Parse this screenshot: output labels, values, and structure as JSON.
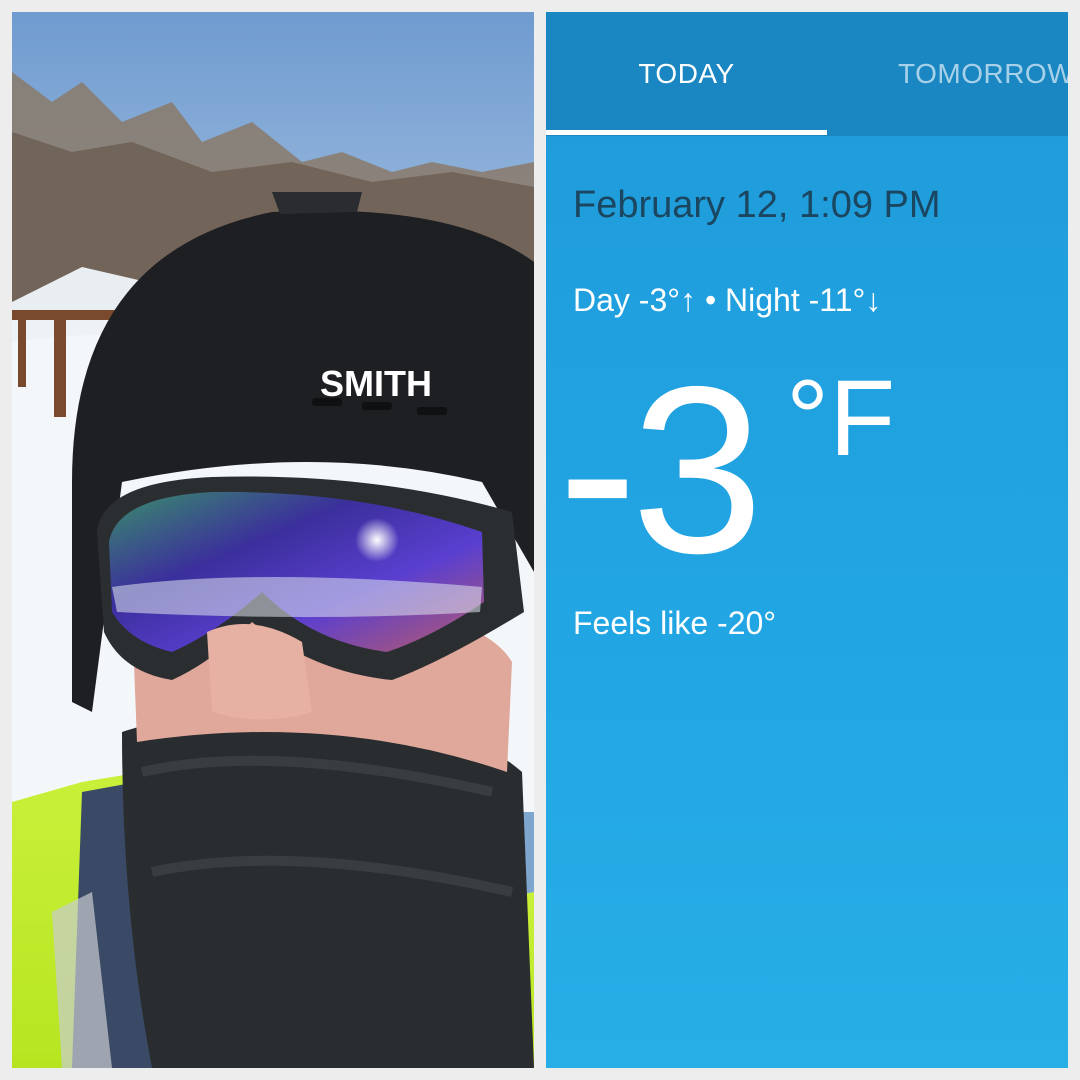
{
  "photo": {
    "helmet_brand": "SMITH",
    "icon": "winter-selfie-photo"
  },
  "weather": {
    "tabs": [
      {
        "label": "TODAY",
        "selected": true
      },
      {
        "label": "TOMORROW",
        "selected": false
      }
    ],
    "date_time": "February 12, 1:09 PM",
    "day_night": "Day -3°↑ • Night -11°↓",
    "temperature": "-3",
    "unit": "°F",
    "feels_like": "Feels like -20°"
  },
  "colors": {
    "tab_bar": "#1a87c2",
    "panel": "#22a5e3",
    "date_text": "#1b4660",
    "border": "#ededed"
  }
}
